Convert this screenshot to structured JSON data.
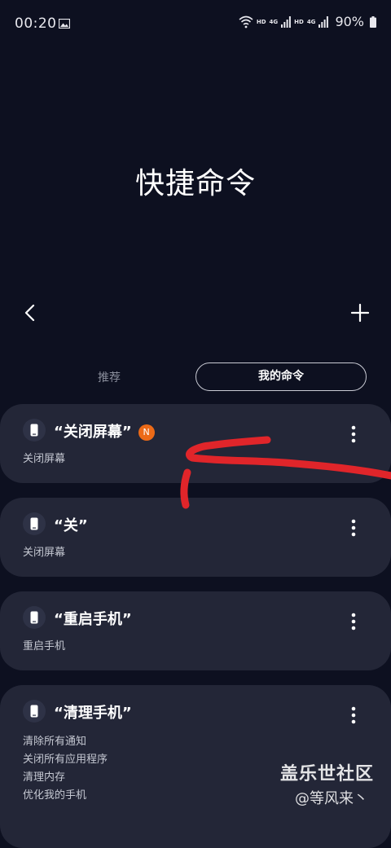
{
  "status_bar": {
    "time": "00:20",
    "network_1": "HD",
    "network_2": "4G",
    "network_3": "HD",
    "network_4": "4G",
    "battery": "90%"
  },
  "header": {
    "title": "快捷命令"
  },
  "tabs": {
    "recommended": "推荐",
    "my_commands": "我的命令"
  },
  "commands": [
    {
      "title": "“关闭屏幕”",
      "badge": "N",
      "actions": [
        "关闭屏幕"
      ]
    },
    {
      "title": "“关”",
      "actions": [
        "关闭屏幕"
      ]
    },
    {
      "title": "“重启手机”",
      "actions": [
        "重启手机"
      ]
    },
    {
      "title": "“清理手机”",
      "actions": [
        "清除所有通知",
        "关闭所有应用程序",
        "清理内存",
        "优化我的手机"
      ]
    }
  ],
  "watermark": {
    "site": "盖乐世社区",
    "author": "@等风来丶"
  },
  "colors": {
    "background": "#0d1020",
    "card": "#232637",
    "badge": "#ec6a17",
    "annotation": "#e0252a"
  }
}
